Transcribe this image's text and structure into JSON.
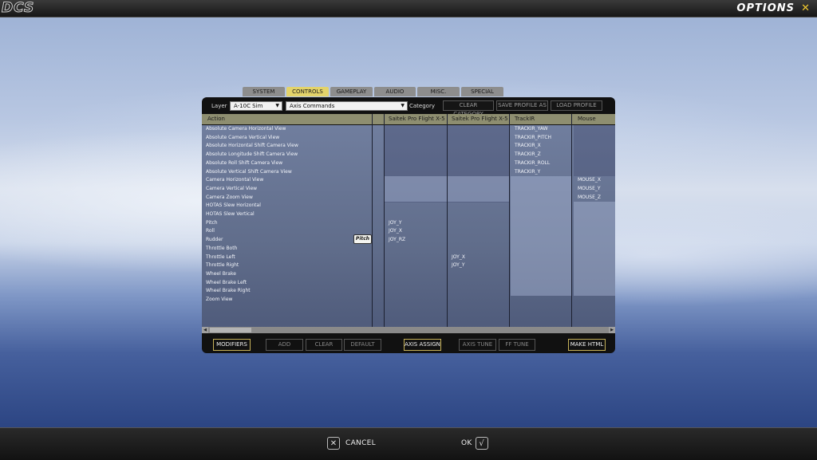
{
  "header": {
    "logo": "DCS",
    "title": "OPTIONS",
    "close_icon": "close-icon"
  },
  "tabs": [
    {
      "label": "SYSTEM",
      "active": false
    },
    {
      "label": "CONTROLS",
      "active": true
    },
    {
      "label": "GAMEPLAY",
      "active": false
    },
    {
      "label": "AUDIO",
      "active": false
    },
    {
      "label": "MISC.",
      "active": false
    },
    {
      "label": "SPECIAL",
      "active": false
    }
  ],
  "toolbar": {
    "layer_label": "Layer",
    "layer_value": "A-10C Sim",
    "commands_value": "Axis Commands",
    "category_label": "Category",
    "clear_category": "CLEAR CATEGORY",
    "save_profile_as": "SAVE PROFILE AS",
    "load_profile": "LOAD PROFILE"
  },
  "columns": [
    "Action",
    "",
    "Saitek Pro Flight X-5",
    "Saitek Pro Flight X-5",
    "TrackIR",
    "Mouse"
  ],
  "rows": [
    {
      "action": "Absolute Camera Horizontal View",
      "joy1": "",
      "joy2": "",
      "trackir": "TRACKIR_YAW",
      "mouse": ""
    },
    {
      "action": "Absolute Camera Vertical View",
      "joy1": "",
      "joy2": "",
      "trackir": "TRACKIR_PITCH",
      "mouse": ""
    },
    {
      "action": "Absolute Horizontal Shift Camera View",
      "joy1": "",
      "joy2": "",
      "trackir": "TRACKIR_X",
      "mouse": ""
    },
    {
      "action": "Absolute Longitude Shift Camera View",
      "joy1": "",
      "joy2": "",
      "trackir": "TRACKIR_Z",
      "mouse": ""
    },
    {
      "action": "Absolute Roll Shift Camera View",
      "joy1": "",
      "joy2": "",
      "trackir": "TRACKIR_ROLL",
      "mouse": ""
    },
    {
      "action": "Absolute Vertical Shift Camera View",
      "joy1": "",
      "joy2": "",
      "trackir": "TRACKIR_Y",
      "mouse": ""
    },
    {
      "action": "Camera Horizontal View",
      "joy1": "",
      "joy2": "",
      "trackir": "",
      "mouse": "MOUSE_X"
    },
    {
      "action": "Camera Vertical View",
      "joy1": "",
      "joy2": "",
      "trackir": "",
      "mouse": "MOUSE_Y"
    },
    {
      "action": "Camera Zoom View",
      "joy1": "",
      "joy2": "",
      "trackir": "",
      "mouse": "MOUSE_Z"
    },
    {
      "action": "HOTAS Slew Horizontal",
      "joy1": "",
      "joy2": "",
      "trackir": "",
      "mouse": ""
    },
    {
      "action": "HOTAS Slew Vertical",
      "joy1": "",
      "joy2": "",
      "trackir": "",
      "mouse": ""
    },
    {
      "action": "Pitch",
      "joy1": "JOY_Y",
      "joy2": "",
      "trackir": "",
      "mouse": ""
    },
    {
      "action": "Roll",
      "joy1": "JOY_X",
      "joy2": "",
      "trackir": "",
      "mouse": ""
    },
    {
      "action": "Rudder",
      "joy1": "JOY_RZ",
      "joy2": "",
      "trackir": "",
      "mouse": ""
    },
    {
      "action": "Throttle Both",
      "joy1": "",
      "joy2": "",
      "trackir": "",
      "mouse": ""
    },
    {
      "action": "Throttle Left",
      "joy1": "",
      "joy2": "JOY_X",
      "trackir": "",
      "mouse": ""
    },
    {
      "action": "Throttle Right",
      "joy1": "",
      "joy2": "JOY_Y",
      "trackir": "",
      "mouse": ""
    },
    {
      "action": "Wheel Brake",
      "joy1": "",
      "joy2": "",
      "trackir": "",
      "mouse": ""
    },
    {
      "action": "Wheel Brake Left",
      "joy1": "",
      "joy2": "",
      "trackir": "",
      "mouse": ""
    },
    {
      "action": "Wheel Brake Right",
      "joy1": "",
      "joy2": "",
      "trackir": "",
      "mouse": ""
    },
    {
      "action": "Zoom View",
      "joy1": "",
      "joy2": "",
      "trackir": "",
      "mouse": ""
    }
  ],
  "tooltip": "Pitch",
  "actions": {
    "modifiers": "MODIFIERS",
    "add": "ADD",
    "clear": "CLEAR",
    "default": "DEFAULT",
    "axis_assign": "AXIS ASSIGN",
    "axis_tune": "AXIS TUNE",
    "ff_tune": "FF TUNE",
    "make_html": "MAKE HTML"
  },
  "footer": {
    "cancel": "CANCEL",
    "ok": "OK",
    "cancel_glyph": "✕",
    "ok_glyph": "√"
  },
  "colors": {
    "accent": "#e3d36a",
    "tab": "#8d8d8d",
    "header": "#8e8e70",
    "close": "#f0c830"
  }
}
